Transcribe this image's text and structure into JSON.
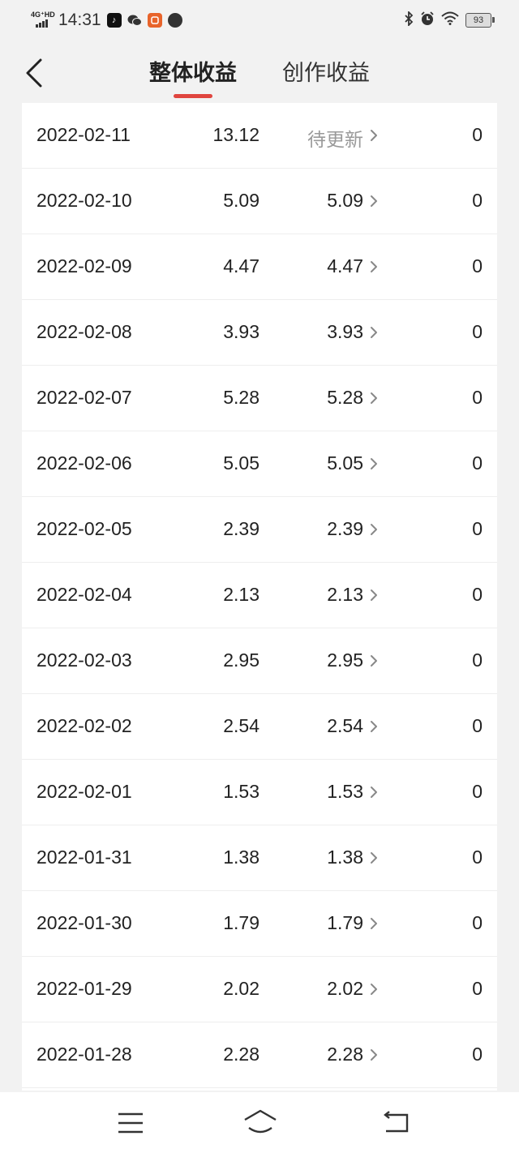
{
  "status_bar": {
    "network_label": "4G⁺HD",
    "time": "14:31",
    "battery": "93",
    "icons": [
      "tiktok-icon",
      "wechat-icon",
      "taobao-icon",
      "compass-icon",
      "bluetooth-icon",
      "alarm-icon",
      "wifi-icon"
    ]
  },
  "header": {
    "back_icon": "chevron-left-icon",
    "tabs": [
      {
        "label": "整体收益",
        "active": true
      },
      {
        "label": "创作收益",
        "active": false
      }
    ],
    "accent_color": "#e0453f"
  },
  "rows": [
    {
      "date": "2022-02-11",
      "total": "13.12",
      "creation": "待更新",
      "other": "0"
    },
    {
      "date": "2022-02-10",
      "total": "5.09",
      "creation": "5.09",
      "other": "0"
    },
    {
      "date": "2022-02-09",
      "total": "4.47",
      "creation": "4.47",
      "other": "0"
    },
    {
      "date": "2022-02-08",
      "total": "3.93",
      "creation": "3.93",
      "other": "0"
    },
    {
      "date": "2022-02-07",
      "total": "5.28",
      "creation": "5.28",
      "other": "0"
    },
    {
      "date": "2022-02-06",
      "total": "5.05",
      "creation": "5.05",
      "other": "0"
    },
    {
      "date": "2022-02-05",
      "total": "2.39",
      "creation": "2.39",
      "other": "0"
    },
    {
      "date": "2022-02-04",
      "total": "2.13",
      "creation": "2.13",
      "other": "0"
    },
    {
      "date": "2022-02-03",
      "total": "2.95",
      "creation": "2.95",
      "other": "0"
    },
    {
      "date": "2022-02-02",
      "total": "2.54",
      "creation": "2.54",
      "other": "0"
    },
    {
      "date": "2022-02-01",
      "total": "1.53",
      "creation": "1.53",
      "other": "0"
    },
    {
      "date": "2022-01-31",
      "total": "1.38",
      "creation": "1.38",
      "other": "0"
    },
    {
      "date": "2022-01-30",
      "total": "1.79",
      "creation": "1.79",
      "other": "0"
    },
    {
      "date": "2022-01-29",
      "total": "2.02",
      "creation": "2.02",
      "other": "0"
    },
    {
      "date": "2022-01-28",
      "total": "2.28",
      "creation": "2.28",
      "other": "0"
    }
  ],
  "nav_bar": {
    "icons": [
      "menu-icon",
      "home-icon",
      "back-icon"
    ]
  }
}
